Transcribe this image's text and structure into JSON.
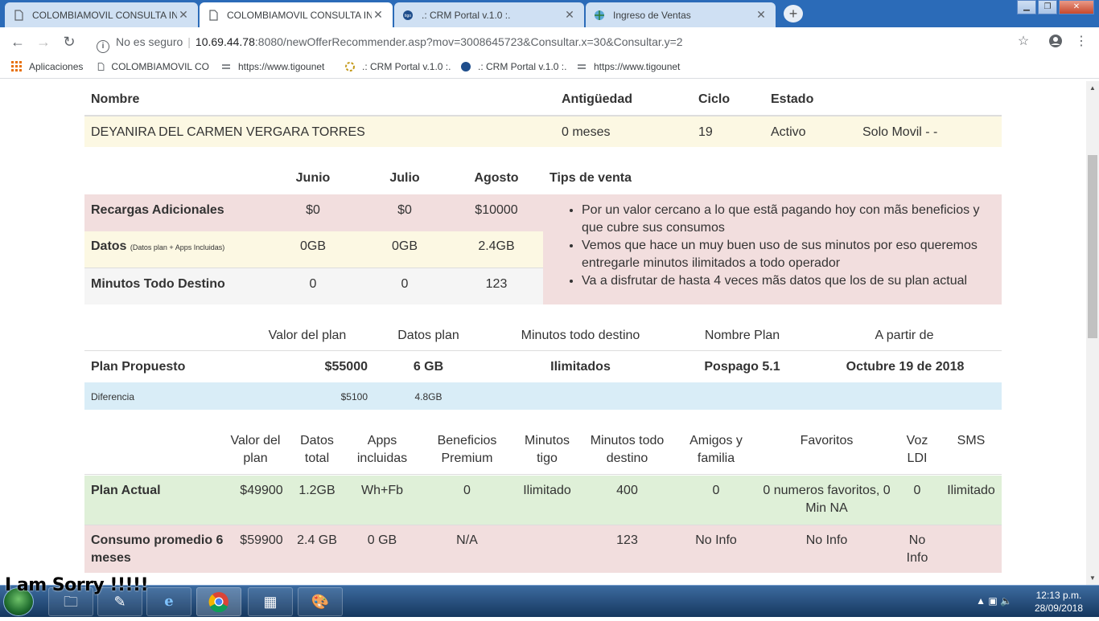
{
  "browser": {
    "tabs": [
      {
        "title": "COLOMBIAMOVIL CONSULTA IN",
        "active": false
      },
      {
        "title": "COLOMBIAMOVIL CONSULTA IN",
        "active": true
      },
      {
        "title": ".: CRM Portal v.1.0 :.",
        "active": false
      },
      {
        "title": "Ingreso de Ventas",
        "active": false
      }
    ],
    "security_text": "No es seguro",
    "url_host": "10.69.44.78",
    "url_rest": ":8080/newOfferRecommender.asp?mov=3008645723&Consultar.x=30&Consultar.y=2",
    "bookmarks": [
      "Aplicaciones",
      "COLOMBIAMOVIL CO",
      "https://www.tigounet",
      ".: CRM Portal v.1.0 :.",
      ".: CRM Portal v.1.0 :.",
      "https://www.tigounet"
    ]
  },
  "customer": {
    "headers": {
      "name": "Nombre",
      "antiquity": "Antigüedad",
      "cycle": "Ciclo",
      "status": "Estado"
    },
    "name": "DEYANIRA DEL CARMEN VERGARA TORRES",
    "antiquity": "0 meses",
    "cycle": "19",
    "status": "Activo",
    "type": "Solo Movil - -"
  },
  "usage": {
    "months": [
      "Junio",
      "Julio",
      "Agosto"
    ],
    "tips_title": "Tips de venta",
    "rows": [
      {
        "label": "Recargas Adicionales",
        "note": "",
        "values": [
          "$0",
          "$0",
          "$10000"
        ]
      },
      {
        "label": "Datos",
        "note": "(Datos plan + Apps Incluidas)",
        "values": [
          "0GB",
          "0GB",
          "2.4GB"
        ]
      },
      {
        "label": "Minutos Todo Destino",
        "note": "",
        "values": [
          "0",
          "0",
          "123"
        ]
      }
    ],
    "tips": [
      "Por un valor cercano a lo que estã pagando hoy con mãs beneficios y que cubre sus consumos",
      "Vemos que hace un muy buen uso de sus minutos por eso queremos entregarle minutos ilimitados a todo operador",
      "Va a disfrutar de hasta 4 veces mãs datos que los de su plan actual"
    ]
  },
  "proposal": {
    "headers": [
      "Valor del plan",
      "Datos plan",
      "Minutos todo destino",
      "Nombre Plan",
      "A partir de"
    ],
    "label": "Plan Propuesto",
    "values": [
      "$55000",
      "6 GB",
      "Ilimitados",
      "Pospago 5.1",
      "Octubre 19 de 2018"
    ],
    "diff_label": "Diferencia",
    "diff_values": [
      "$5100",
      "4.8GB"
    ]
  },
  "comparison": {
    "headers": [
      "Valor del plan",
      "Datos total",
      "Apps incluidas",
      "Beneficios Premium",
      "Minutos tigo",
      "Minutos todo destino",
      "Amigos y familia",
      "Favoritos",
      "Voz LDI",
      "SMS"
    ],
    "rows": [
      {
        "label": "Plan Actual",
        "values": [
          "$49900",
          "1.2GB",
          "Wh+Fb",
          "0",
          "Ilimitado",
          "400",
          "0",
          "0 numeros favoritos, 0 Min NA",
          "0",
          "Ilimitado"
        ]
      },
      {
        "label": "Consumo promedio 6 meses",
        "values": [
          "$59900",
          "2.4 GB",
          "0 GB",
          "N/A",
          "",
          "123",
          "No Info",
          "No Info",
          "No Info",
          ""
        ]
      }
    ]
  },
  "overlay_text": "I am Sorry !!!!!",
  "taskbar": {
    "time": "12:13 p.m.",
    "date": "28/09/2018"
  }
}
